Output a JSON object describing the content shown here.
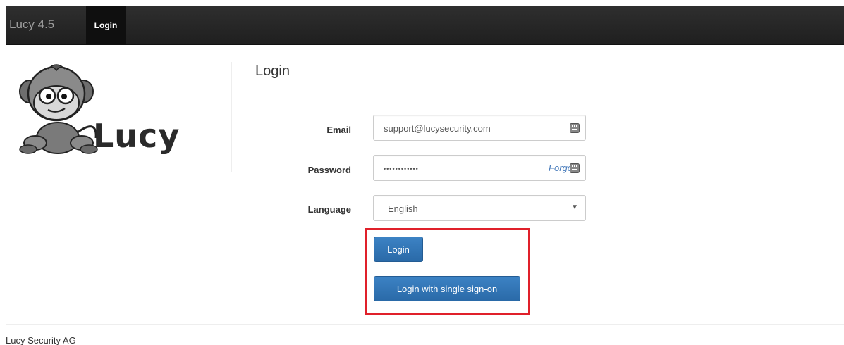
{
  "navbar": {
    "brand": "Lucy 4.5",
    "active_tab": "Login"
  },
  "logo": {
    "wordmark": "Lucy"
  },
  "page": {
    "title": "Login"
  },
  "form": {
    "email_label": "Email",
    "email_value": "support@lucysecurity.com",
    "password_label": "Password",
    "password_value": "••••••••••••",
    "forgot_text": "Forgo",
    "language_label": "Language",
    "language_value": "English"
  },
  "buttons": {
    "login": "Login",
    "sso": "Login with single sign-on"
  },
  "footer": {
    "company": "Lucy Security AG"
  },
  "colors": {
    "navbar": "#222222",
    "primary_button": "#337ab7",
    "highlight": "#e0202a",
    "link": "#4a7dbc"
  }
}
